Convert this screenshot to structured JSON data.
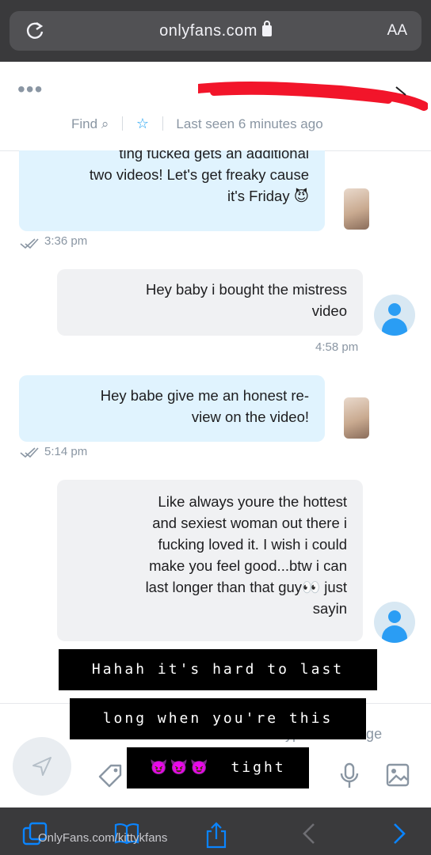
{
  "browser": {
    "url": "onlyfans.com",
    "text_size_label": "AA",
    "bottom_url": "OnlyFans.com/kittykfans"
  },
  "header": {
    "menu_dots": "•••",
    "last_seen": "Last seen 6 minutes ago",
    "find_label": "Find",
    "star_icon": "star-icon"
  },
  "messages": [
    {
      "text_lines": [
        "ting fucked gets an additional",
        "two videos! Let's get freaky cause",
        "it's Friday 😈"
      ],
      "time": "3:36 pm",
      "sender": "creator"
    },
    {
      "text_lines": [
        "Hey baby i bought the mistress",
        "video"
      ],
      "time": "4:58 pm",
      "sender": "user"
    },
    {
      "text_lines": [
        "Hey babe give me an honest re-",
        "view on the video!"
      ],
      "time": "5:14 pm",
      "sender": "creator"
    },
    {
      "text_lines": [
        "Like always youre the hottest",
        "and sexiest woman out there i",
        "fucking loved it. I wish i could",
        "make you feel good...btw i can",
        "last longer than that guy👀 just",
        "sayin"
      ],
      "time": "",
      "sender": "user"
    }
  ],
  "captions": [
    {
      "text": "Hahah it's hard to last"
    },
    {
      "text": "long when you're this"
    },
    {
      "text": "tight",
      "emoji": "😈😈😈"
    }
  ],
  "composer": {
    "placeholder": "Type a message"
  },
  "colors": {
    "accent": "#1da1f2",
    "blue_bubble": "#e0f3fe",
    "grey_bubble": "#f0f1f3",
    "muted_text": "#8a96a3"
  }
}
